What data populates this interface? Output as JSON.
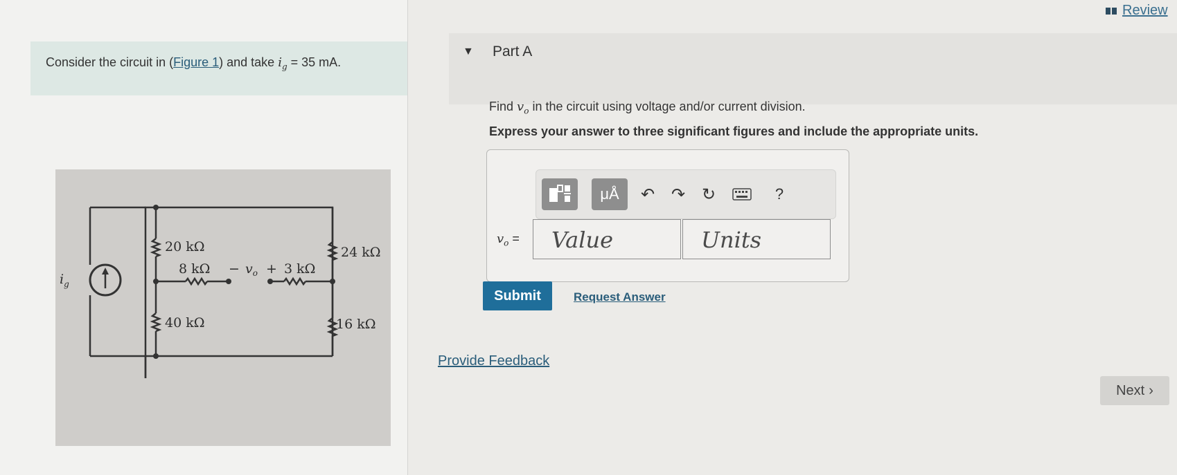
{
  "problem": {
    "prefix": "Consider the circuit in (",
    "figure_link": "Figure 1",
    "middle": ") and take ",
    "var": "i",
    "var_sub": "g",
    "equation": " = 35 mA."
  },
  "figure": {
    "source_label": "i",
    "source_sub": "g",
    "r1": "20 kΩ",
    "r2": "24 kΩ",
    "r3": "8 kΩ",
    "r4": "3 kΩ",
    "r5": "40 kΩ",
    "r6": "16 kΩ",
    "minus": "−",
    "plus": "+",
    "vo": "v",
    "vo_sub": "o"
  },
  "header": {
    "review_label": "Review",
    "part_title": "Part A"
  },
  "question": {
    "find": "Find ",
    "var": "v",
    "var_sub": "o",
    "rest": " in the circuit using voltage and/or current division.",
    "express": "Express your answer to three significant figures and include the appropriate units."
  },
  "answer": {
    "var": "v",
    "var_sub": "o",
    "equals": " =",
    "value_placeholder": "Value",
    "units_placeholder": "Units"
  },
  "toolbar": {
    "units_label": "μÅ",
    "help_label": "?",
    "icons": [
      "templates-icon",
      "units-icon",
      "undo-icon",
      "redo-icon",
      "reset-icon",
      "keyboard-icon",
      "help-icon"
    ]
  },
  "actions": {
    "submit": "Submit",
    "request_answer": "Request Answer",
    "provide_feedback": "Provide Feedback",
    "next": "Next"
  }
}
